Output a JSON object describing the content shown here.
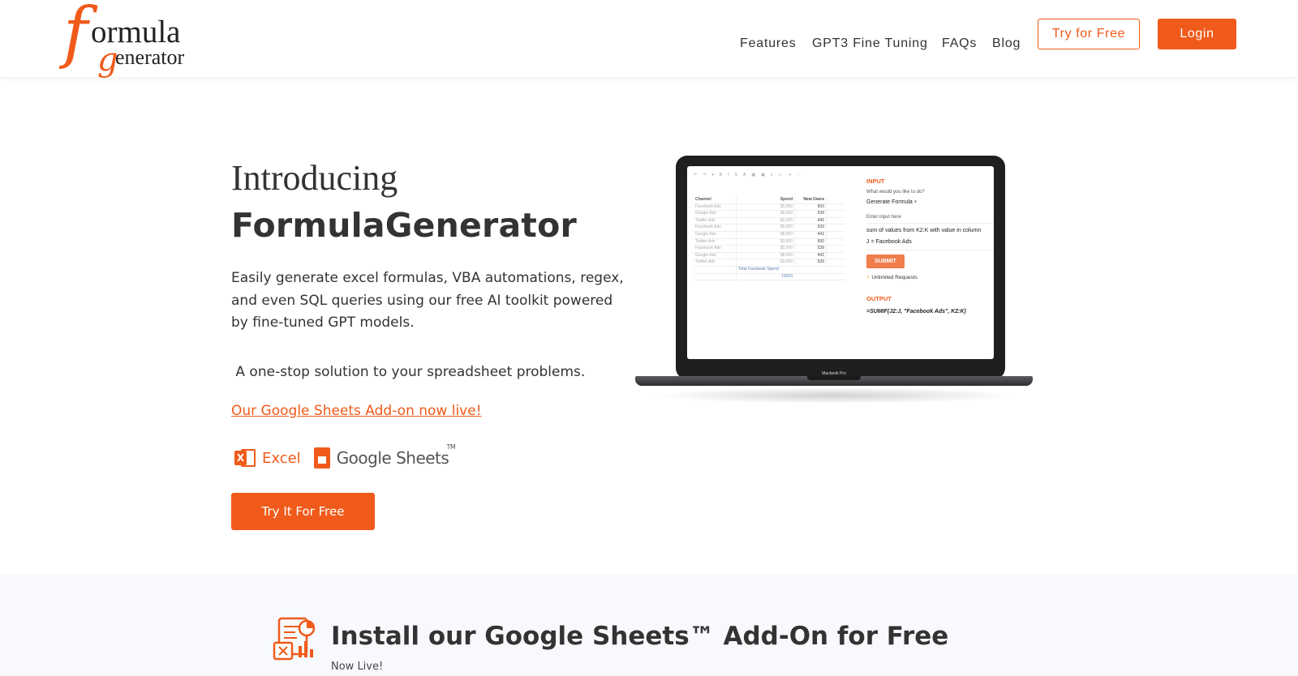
{
  "header": {
    "logo": {
      "big_f": "f",
      "big_g": "g",
      "word_top": "ormula",
      "word_bottom": "enerator"
    },
    "nav": [
      "Features",
      "GPT3 Fine Tuning",
      "FAQs",
      "Blog"
    ],
    "try_label": "Try for Free",
    "login_label": "Login"
  },
  "hero": {
    "intro": "Introducing",
    "brand": "FormulaGenerator",
    "description": "Easily generate excel formulas, VBA automations, regex, and even SQL queries using our free AI toolkit powered by fine-tuned GPT models.",
    "one_stop": " A one-stop solution to your spreadsheet problems.",
    "addon_link": "Our Google Sheets Add-on now live!",
    "excel_label": "Excel",
    "sheets_label": "Google Sheets",
    "sheets_tm": "TM",
    "cta_label": "Try It For Free"
  },
  "laptop": {
    "model": "Macbook Pro",
    "sheet": {
      "headers": [
        "Channel",
        "Spend",
        "New Users"
      ],
      "rows": [
        [
          "Facebook Ads",
          "$5,000",
          "500"
        ],
        [
          "Google Ads",
          "$8,000",
          "539"
        ],
        [
          "Twitter Ads",
          "$3,000",
          "442"
        ],
        [
          "Facebook Ads",
          "$5,000",
          "539"
        ],
        [
          "Google Ads",
          "$8,000",
          "442"
        ],
        [
          "Twitter Ads",
          "$3,000",
          "500"
        ],
        [
          "Facebook Ads",
          "$5,000",
          "539"
        ],
        [
          "Google Ads",
          "$8,000",
          "442"
        ],
        [
          "Twitter Ads",
          "$3,000",
          "539"
        ]
      ],
      "total_label": "Total Facebook Spend",
      "total_value": "15000"
    },
    "panel": {
      "input_label": "INPUT",
      "question": "What would you like to do?",
      "select_value": "Generate Formula",
      "input_hint": "Enter input here",
      "input_line1": "sum of values from K2:K with value in column",
      "input_line2": "J = Facebook Ads",
      "submit": "SUBMIT",
      "unlimited": "Unlimited Requests",
      "output_label": "OUTPUT",
      "output_text": "=SUMIF(J2:J, \"Facebook Ads\", K2:K)"
    }
  },
  "band": {
    "title": "Install our Google Sheets™ Add-On for Free",
    "subtitle": "Now Live!"
  },
  "colors": {
    "accent": "#f05a1a",
    "band_bg": "#f7f9fc",
    "text": "#333333"
  }
}
